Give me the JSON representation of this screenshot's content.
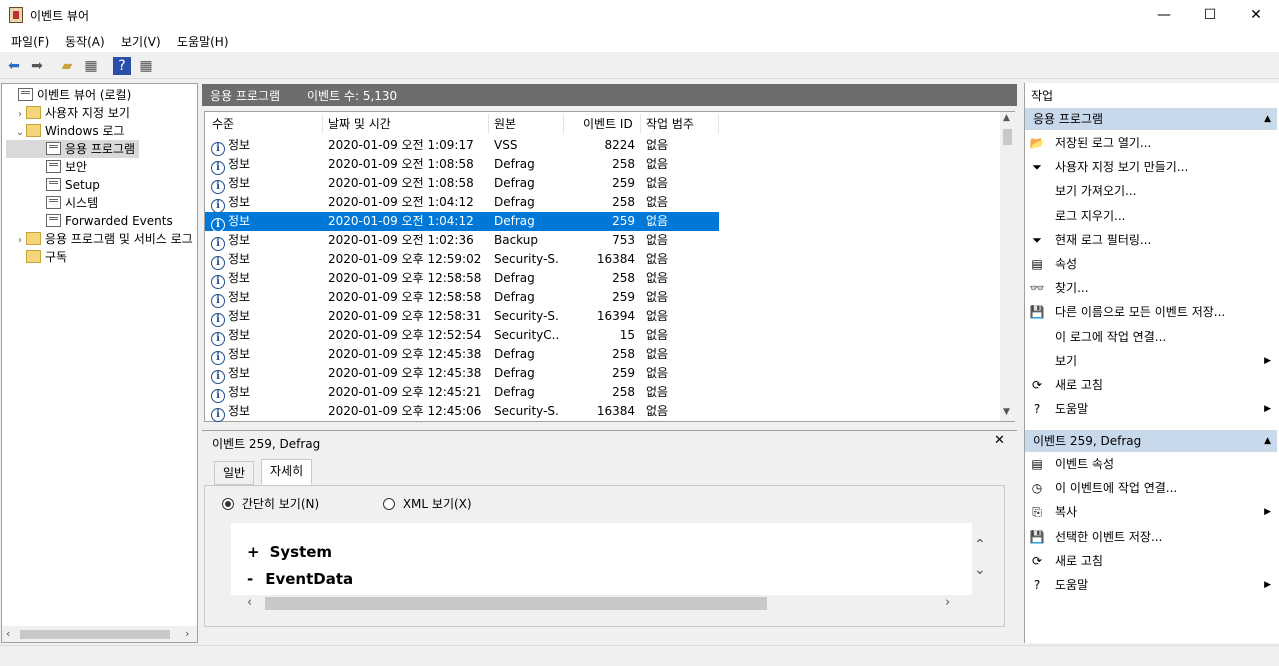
{
  "window": {
    "title": "이벤트 뷰어",
    "minimize": "—",
    "maximize": "☐",
    "close": "✕"
  },
  "menu": [
    "파일(F)",
    "동작(A)",
    "보기(V)",
    "도움말(H)"
  ],
  "tree": [
    {
      "label": "이벤트 뷰어 (로컬)",
      "chev": "",
      "icon": "log"
    },
    {
      "label": "사용자 지정 보기",
      "chev": "›",
      "icon": "folder"
    },
    {
      "label": "Windows 로그",
      "chev": "⌄",
      "icon": "folder"
    },
    {
      "label": "응용 프로그램",
      "chev": "",
      "icon": "log"
    },
    {
      "label": "보안",
      "chev": "",
      "icon": "log"
    },
    {
      "label": "Setup",
      "chev": "",
      "icon": "log"
    },
    {
      "label": "시스템",
      "chev": "",
      "icon": "log"
    },
    {
      "label": "Forwarded Events",
      "chev": "",
      "icon": "log"
    },
    {
      "label": "응용 프로그램 및 서비스 로그",
      "chev": "›",
      "icon": "folder"
    },
    {
      "label": "구독",
      "chev": "",
      "icon": "folder"
    }
  ],
  "center": {
    "title": "응용 프로그램",
    "count": "이벤트 수: 5,130"
  },
  "columns": [
    "수준",
    "날짜 및 시간",
    "원본",
    "이벤트 ID",
    "작업 범주"
  ],
  "events": [
    {
      "level": "정보",
      "date": "2020-01-09 오전 1:09:17",
      "source": "VSS",
      "id": "8224",
      "category": "없음"
    },
    {
      "level": "정보",
      "date": "2020-01-09 오전 1:08:58",
      "source": "Defrag",
      "id": "258",
      "category": "없음"
    },
    {
      "level": "정보",
      "date": "2020-01-09 오전 1:08:58",
      "source": "Defrag",
      "id": "259",
      "category": "없음"
    },
    {
      "level": "정보",
      "date": "2020-01-09 오전 1:04:12",
      "source": "Defrag",
      "id": "258",
      "category": "없음"
    },
    {
      "level": "정보",
      "date": "2020-01-09 오전 1:04:12",
      "source": "Defrag",
      "id": "259",
      "category": "없음"
    },
    {
      "level": "정보",
      "date": "2020-01-09 오전 1:02:36",
      "source": "Backup",
      "id": "753",
      "category": "없음"
    },
    {
      "level": "정보",
      "date": "2020-01-09 오후 12:59:02",
      "source": "Security-S...",
      "id": "16384",
      "category": "없음"
    },
    {
      "level": "정보",
      "date": "2020-01-09 오후 12:58:58",
      "source": "Defrag",
      "id": "258",
      "category": "없음"
    },
    {
      "level": "정보",
      "date": "2020-01-09 오후 12:58:58",
      "source": "Defrag",
      "id": "259",
      "category": "없음"
    },
    {
      "level": "정보",
      "date": "2020-01-09 오후 12:58:31",
      "source": "Security-S...",
      "id": "16394",
      "category": "없음"
    },
    {
      "level": "정보",
      "date": "2020-01-09 오후 12:52:54",
      "source": "SecurityC...",
      "id": "15",
      "category": "없음"
    },
    {
      "level": "정보",
      "date": "2020-01-09 오후 12:45:38",
      "source": "Defrag",
      "id": "258",
      "category": "없음"
    },
    {
      "level": "정보",
      "date": "2020-01-09 오후 12:45:38",
      "source": "Defrag",
      "id": "259",
      "category": "없음"
    },
    {
      "level": "정보",
      "date": "2020-01-09 오후 12:45:21",
      "source": "Defrag",
      "id": "258",
      "category": "없음"
    },
    {
      "level": "정보",
      "date": "2020-01-09 오후 12:45:06",
      "source": "Security-S...",
      "id": "16384",
      "category": "없음"
    }
  ],
  "detail": {
    "title": "이벤트 259, Defrag",
    "tabs": [
      "일반",
      "자세히"
    ],
    "radio_friendly": "간단히 보기(N)",
    "radio_xml": "XML 보기(X)",
    "nodes": [
      {
        "sign": "+",
        "label": "System"
      },
      {
        "sign": "-",
        "label": "EventData"
      }
    ]
  },
  "actions": {
    "header": "작업",
    "section1": "응용 프로그램",
    "items1": [
      {
        "label": "저장된 로그 열기...",
        "icon": "📂",
        "arrow": ""
      },
      {
        "label": "사용자 지정 보기 만들기...",
        "icon": "⏷",
        "arrow": ""
      },
      {
        "label": "보기 가져오기...",
        "icon": "",
        "arrow": ""
      },
      {
        "label": "로그 지우기...",
        "icon": "",
        "arrow": ""
      },
      {
        "label": "현재 로그 필터링...",
        "icon": "⏷",
        "arrow": ""
      },
      {
        "label": "속성",
        "icon": "▤",
        "arrow": ""
      },
      {
        "label": "찾기...",
        "icon": "👓",
        "arrow": ""
      },
      {
        "label": "다른 이름으로 모든 이벤트 저장...",
        "icon": "💾",
        "arrow": ""
      },
      {
        "label": "이 로그에 작업 연결...",
        "icon": "",
        "arrow": ""
      },
      {
        "label": "보기",
        "icon": "",
        "arrow": "▶"
      },
      {
        "label": "새로 고침",
        "icon": "⟳",
        "arrow": ""
      },
      {
        "label": "도움말",
        "icon": "?",
        "arrow": "▶"
      }
    ],
    "section2": "이벤트 259, Defrag",
    "items2": [
      {
        "label": "이벤트 속성",
        "icon": "▤",
        "arrow": ""
      },
      {
        "label": "이 이벤트에 작업 연결...",
        "icon": "◷",
        "arrow": ""
      },
      {
        "label": "복사",
        "icon": "⎘",
        "arrow": "▶"
      },
      {
        "label": "선택한 이벤트 저장...",
        "icon": "💾",
        "arrow": ""
      },
      {
        "label": "새로 고침",
        "icon": "⟳",
        "arrow": ""
      },
      {
        "label": "도움말",
        "icon": "?",
        "arrow": "▶"
      }
    ]
  },
  "colors": {
    "selection": "#0078d7",
    "section_bg": "#c9d9ec",
    "header_bg": "#6d6d6d"
  }
}
